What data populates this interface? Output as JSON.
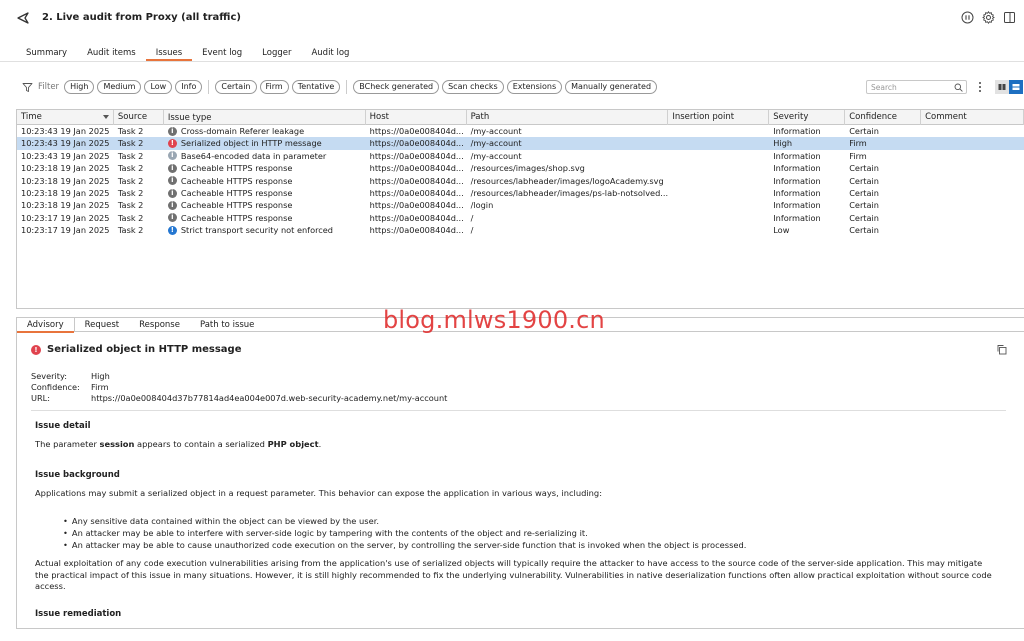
{
  "window": {
    "title": "2. Live audit from Proxy (all traffic)"
  },
  "tabs": [
    "Summary",
    "Audit items",
    "Issues",
    "Event log",
    "Logger",
    "Audit log"
  ],
  "active_tab": "Issues",
  "filter": {
    "label": "Filter",
    "severity_chips": [
      "High",
      "Medium",
      "Low",
      "Info"
    ],
    "confidence_chips": [
      "Certain",
      "Firm",
      "Tentative"
    ],
    "source_chips": [
      "BCheck generated",
      "Scan checks",
      "Extensions",
      "Manually generated"
    ],
    "search_placeholder": "Search"
  },
  "table": {
    "columns": [
      "Time",
      "Source",
      "Issue type",
      "Host",
      "Path",
      "Insertion point",
      "Severity",
      "Confidence",
      "Comment"
    ],
    "rows": [
      {
        "time": "10:23:43 19 Jan 2025",
        "source": "Task 2",
        "icon": "info",
        "type": "Cross-domain Referer leakage",
        "host": "https://0a0e008404d...",
        "path": "/my-account",
        "insertion": "",
        "severity": "Information",
        "confidence": "Certain",
        "comment": ""
      },
      {
        "time": "10:23:43 19 Jan 2025",
        "source": "Task 2",
        "icon": "high",
        "type": "Serialized object in HTTP message",
        "host": "https://0a0e008404d...",
        "path": "/my-account",
        "insertion": "",
        "severity": "High",
        "confidence": "Firm",
        "comment": ""
      },
      {
        "time": "10:23:43 19 Jan 2025",
        "source": "Task 2",
        "icon": "info-light",
        "type": "Base64-encoded data in parameter",
        "host": "https://0a0e008404d...",
        "path": "/my-account",
        "insertion": "",
        "severity": "Information",
        "confidence": "Firm",
        "comment": ""
      },
      {
        "time": "10:23:18 19 Jan 2025",
        "source": "Task 2",
        "icon": "info",
        "type": "Cacheable HTTPS response",
        "host": "https://0a0e008404d...",
        "path": "/resources/images/shop.svg",
        "insertion": "",
        "severity": "Information",
        "confidence": "Certain",
        "comment": ""
      },
      {
        "time": "10:23:18 19 Jan 2025",
        "source": "Task 2",
        "icon": "info",
        "type": "Cacheable HTTPS response",
        "host": "https://0a0e008404d...",
        "path": "/resources/labheader/images/logoAcademy.svg",
        "insertion": "",
        "severity": "Information",
        "confidence": "Certain",
        "comment": ""
      },
      {
        "time": "10:23:18 19 Jan 2025",
        "source": "Task 2",
        "icon": "info",
        "type": "Cacheable HTTPS response",
        "host": "https://0a0e008404d...",
        "path": "/resources/labheader/images/ps-lab-notsolved....",
        "insertion": "",
        "severity": "Information",
        "confidence": "Certain",
        "comment": ""
      },
      {
        "time": "10:23:18 19 Jan 2025",
        "source": "Task 2",
        "icon": "info",
        "type": "Cacheable HTTPS response",
        "host": "https://0a0e008404d...",
        "path": "/login",
        "insertion": "",
        "severity": "Information",
        "confidence": "Certain",
        "comment": ""
      },
      {
        "time": "10:23:17 19 Jan 2025",
        "source": "Task 2",
        "icon": "info",
        "type": "Cacheable HTTPS response",
        "host": "https://0a0e008404d...",
        "path": "/",
        "insertion": "",
        "severity": "Information",
        "confidence": "Certain",
        "comment": ""
      },
      {
        "time": "10:23:17 19 Jan 2025",
        "source": "Task 2",
        "icon": "low",
        "type": "Strict transport security not enforced",
        "host": "https://0a0e008404d...",
        "path": "/",
        "insertion": "",
        "severity": "Low",
        "confidence": "Certain",
        "comment": ""
      }
    ],
    "selected_index": 1
  },
  "lower_tabs": [
    "Advisory",
    "Request",
    "Response",
    "Path to issue"
  ],
  "advisory": {
    "title": "Serialized object in HTTP message",
    "severity_label": "Severity:",
    "severity_value": "High",
    "confidence_label": "Confidence:",
    "confidence_value": "Firm",
    "url_label": "URL:",
    "url_value": "https://0a0e008404d37b77814ad4ea004e007d.web-security-academy.net/my-account",
    "issue_detail_heading": "Issue detail",
    "issue_detail_pre": "The parameter ",
    "issue_detail_param": "session",
    "issue_detail_mid": " appears to contain a serialized ",
    "issue_detail_obj": "PHP object",
    "issue_detail_post": ".",
    "issue_background_heading": "Issue background",
    "background_intro": "Applications may submit a serialized object in a request parameter. This behavior can expose the application in various ways, including:",
    "background_bullets": [
      "Any sensitive data contained within the object can be viewed by the user.",
      "An attacker may be able to interfere with server-side logic by tampering with the contents of the object and re-serializing it.",
      "An attacker may be able to cause unauthorized code execution on the server, by controlling the server-side function that is invoked when the object is processed."
    ],
    "background_para": "Actual exploitation of any code execution vulnerabilities arising from the application's use of serialized objects will typically require the attacker to have access to the source code of the server-side application. This may mitigate the practical impact of this issue in many situations. However, it is still highly recommended to fix the underlying vulnerability. Vulnerabilities in native deserialization functions often allow practical exploitation without source code access.",
    "issue_remediation_heading": "Issue remediation"
  },
  "watermark": "blog.mlws1900.cn",
  "colors": {
    "accent": "#e8743c",
    "selected_row": "#c5dbf2",
    "high": "#e0434e",
    "low": "#2477d1",
    "info": "#707070"
  }
}
